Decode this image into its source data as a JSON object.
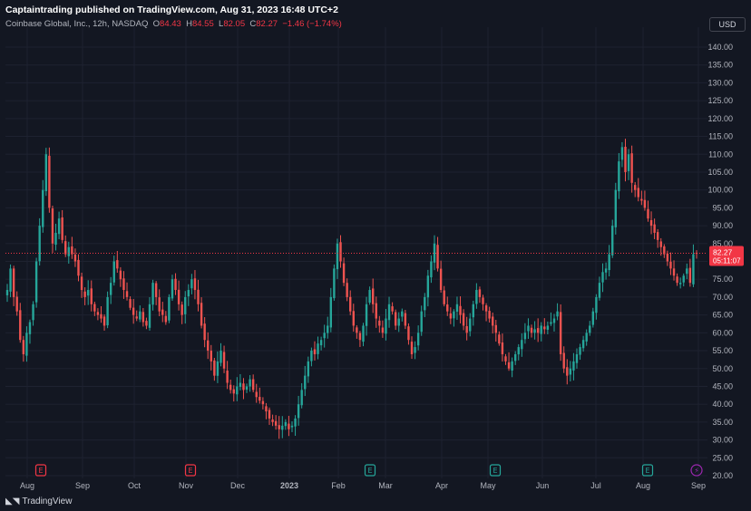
{
  "header": {
    "publisher_line": "Captaintrading published on TradingView.com, Aug 31, 2023 16:48 UTC+2"
  },
  "legend": {
    "symbol": "Coinbase Global, Inc., 12h, NASDAQ",
    "open_label": "O",
    "open": "84.43",
    "high_label": "H",
    "high": "84.55",
    "low_label": "L",
    "low": "82.05",
    "close_label": "C",
    "close": "82.27",
    "change": "−1.46 (−1.74%)"
  },
  "currency": "USD",
  "footer": {
    "brand": "TradingView"
  },
  "colors": {
    "up": "#26a69a",
    "down": "#ef5350",
    "background": "#131722",
    "grid": "#1e2230",
    "axis_text": "#b2b5be",
    "last_price": "#f23645"
  },
  "chart_data": {
    "type": "candlestick",
    "y_axis": {
      "min": 20,
      "max": 145,
      "ticks": [
        20,
        25,
        30,
        35,
        40,
        45,
        50,
        55,
        60,
        65,
        70,
        75,
        80,
        85,
        90,
        95,
        100,
        105,
        110,
        115,
        120,
        125,
        130,
        135,
        140
      ]
    },
    "x_axis": {
      "labels": [
        "Aug",
        "Sep",
        "Oct",
        "Nov",
        "Dec",
        "2023",
        "Feb",
        "Mar",
        "Apr",
        "May",
        "Jun",
        "Jul",
        "Aug",
        "Sep"
      ]
    },
    "last_price": {
      "value": 82.27,
      "label": "82.27",
      "countdown": "05:11:07"
    },
    "event_markers": [
      {
        "type": "earnings",
        "label": "E",
        "color": "#f23645",
        "after_label": "Aug"
      },
      {
        "type": "earnings",
        "label": "E",
        "color": "#f23645",
        "after_label": "Nov"
      },
      {
        "type": "earnings",
        "label": "E",
        "color": "#26a69a",
        "after_label": "Feb"
      },
      {
        "type": "earnings",
        "label": "E",
        "color": "#26a69a",
        "after_label": "Apr"
      },
      {
        "type": "earnings",
        "label": "E",
        "color": "#26a69a",
        "after_label": "Jul"
      },
      {
        "type": "split",
        "label": "⚡",
        "color": "#9c27b0",
        "after_label": "Aug"
      }
    ],
    "closes": [
      72,
      78,
      70,
      66,
      58,
      54,
      60,
      63,
      68,
      80,
      90,
      100,
      110,
      95,
      85,
      88,
      92,
      86,
      82,
      84,
      82,
      80,
      76,
      72,
      70,
      72,
      68,
      66,
      65,
      64,
      62,
      70,
      74,
      80,
      78,
      75,
      72,
      70,
      67,
      65,
      64,
      66,
      63,
      62,
      68,
      74,
      70,
      66,
      65,
      63,
      70,
      75,
      72,
      68,
      65,
      70,
      72,
      75,
      72,
      68,
      62,
      58,
      55,
      52,
      48,
      52,
      55,
      50,
      46,
      44,
      43,
      45,
      46,
      44,
      45,
      47,
      44,
      42,
      41,
      40,
      38,
      36,
      35,
      34,
      33,
      34,
      35,
      33,
      34,
      36,
      40,
      44,
      48,
      52,
      55,
      54,
      57,
      58,
      60,
      62,
      70,
      78,
      85,
      80,
      74,
      70,
      66,
      62,
      60,
      58,
      62,
      68,
      72,
      68,
      64,
      62,
      60,
      64,
      68,
      66,
      62,
      64,
      66,
      62,
      58,
      54,
      56,
      60,
      66,
      70,
      76,
      80,
      85,
      78,
      72,
      68,
      66,
      64,
      66,
      68,
      65,
      62,
      60,
      64,
      68,
      72,
      70,
      68,
      66,
      64,
      62,
      60,
      57,
      54,
      52,
      50,
      52,
      54,
      56,
      58,
      60,
      62,
      60,
      61,
      60,
      62,
      61,
      62,
      63,
      64,
      66,
      54,
      50,
      48,
      50,
      52,
      54,
      56,
      58,
      60,
      62,
      66,
      70,
      74,
      77,
      78,
      82,
      90,
      100,
      108,
      112,
      105,
      110,
      102,
      100,
      98,
      97,
      95,
      92,
      90,
      88,
      86,
      84,
      82,
      80,
      78,
      76,
      74,
      74,
      76,
      78,
      74,
      82,
      82.27
    ]
  }
}
